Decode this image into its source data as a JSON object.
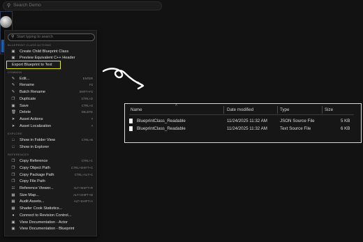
{
  "topbar": {
    "placeholder": "Search Demo",
    "icon": "search-icon"
  },
  "menu": {
    "search_placeholder": "Start typing to search",
    "sections": {
      "blueprint_class_actions": "BLUEPRINT CLASS ACTIONS",
      "common": "COMMON",
      "explore": "EXPLORE",
      "references": "REFERENCES"
    },
    "items": [
      {
        "label": "Create Child Blueprint Class",
        "shortcut": "",
        "icon": "blueprint-icon"
      },
      {
        "label": "Preview Equivalent C++ Header",
        "shortcut": "",
        "icon": "code-icon"
      },
      {
        "label": "Export Blueprint to Text",
        "shortcut": "",
        "icon": ""
      },
      {
        "label": "Edit...",
        "shortcut": "ENTER",
        "icon": "edit-icon"
      },
      {
        "label": "Rename",
        "shortcut": "F2",
        "icon": "rename-icon"
      },
      {
        "label": "Batch Rename",
        "shortcut": "SHIFT+F2",
        "icon": "batch-rename-icon"
      },
      {
        "label": "Duplicate",
        "shortcut": "CTRL+D",
        "icon": "duplicate-icon"
      },
      {
        "label": "Save",
        "shortcut": "CTRL+S",
        "icon": "save-icon"
      },
      {
        "label": "Delete",
        "shortcut": "DELETE",
        "icon": "delete-icon"
      },
      {
        "label": "Asset Actions",
        "shortcut": "",
        "icon": "asset-actions-icon",
        "submenu": true
      },
      {
        "label": "Asset Localization",
        "shortcut": "",
        "icon": "localization-icon",
        "submenu": true
      },
      {
        "label": "Show in Folder View",
        "shortcut": "CTRL+B",
        "icon": "folder-icon"
      },
      {
        "label": "Show in Explorer",
        "shortcut": "",
        "icon": "explorer-icon"
      },
      {
        "label": "Copy Reference",
        "shortcut": "CTRL+C",
        "icon": "copy-icon"
      },
      {
        "label": "Copy Object Path",
        "shortcut": "CTRL+SHIFT+C",
        "icon": "copy-icon"
      },
      {
        "label": "Copy Package Path",
        "shortcut": "CTRL+ALT+C",
        "icon": "copy-icon"
      },
      {
        "label": "Copy File Path",
        "shortcut": "",
        "icon": "copy-icon"
      },
      {
        "label": "Reference Viewer...",
        "shortcut": "ALT+SHIFT+R",
        "icon": "reference-viewer-icon"
      },
      {
        "label": "Size Map...",
        "shortcut": "ALT+SHIFT+M",
        "icon": "size-map-icon"
      },
      {
        "label": "Audit Assets...",
        "shortcut": "ALT+SHIFT+A",
        "icon": "audit-icon"
      },
      {
        "label": "Shader Cook Statistics...",
        "shortcut": "",
        "icon": "stats-icon"
      },
      {
        "label": "Connect to Revision Control...",
        "shortcut": "",
        "icon": "revision-control-icon"
      },
      {
        "label": "View Documentation - Actor",
        "shortcut": "",
        "icon": "documentation-icon"
      },
      {
        "label": "View Documentation - Blueprint",
        "shortcut": "",
        "icon": "documentation-icon"
      }
    ]
  },
  "explorer": {
    "columns": {
      "name": "Name",
      "date": "Date modified",
      "type": "Type",
      "size": "Size"
    },
    "rows": [
      {
        "name": "BlueprintClass_Readable",
        "date": "11/24/2025 11:32 AM",
        "type": "JSON Source File",
        "size": "5 KB"
      },
      {
        "name": "BlueprintClass_Readable",
        "date": "11/24/2025 11:32 AM",
        "type": "Text Source File",
        "size": "6 KB"
      }
    ]
  },
  "colors": {
    "highlight": "#e5e61a",
    "selection_blue": "#1f6fd1",
    "panel_border": "#d9d9d9"
  }
}
